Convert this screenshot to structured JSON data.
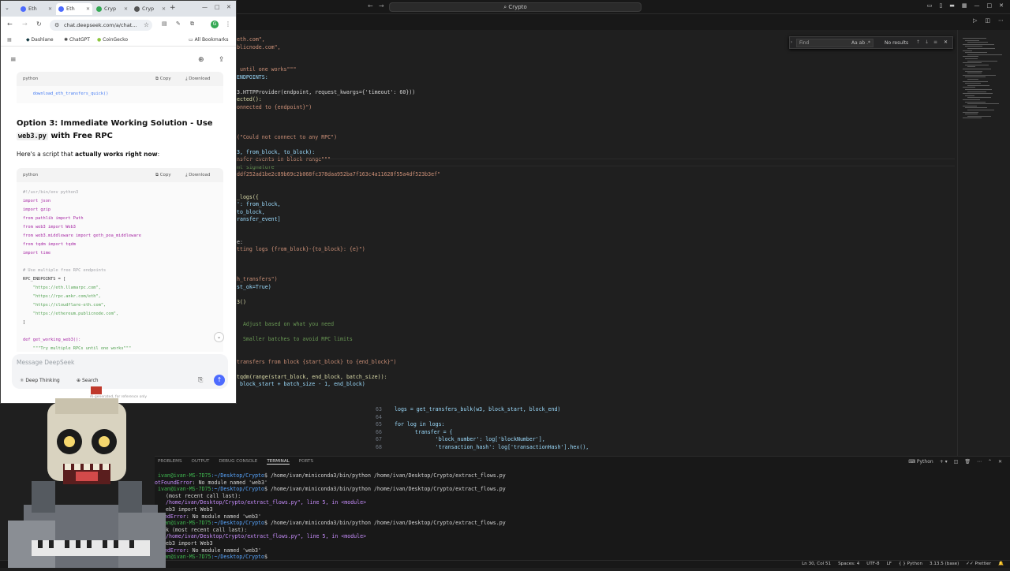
{
  "vscode": {
    "search_text": "Crypto",
    "find": {
      "placeholder": "Find",
      "aa": "Aa",
      "ab": "ab",
      "regex": ".*",
      "results": "No results"
    },
    "code_lines": [
      {
        "t": "eth.com\",",
        "c": "str"
      },
      {
        "t": "blicnode.com\",",
        "c": "str"
      },
      {
        "t": "",
        "c": ""
      },
      {
        "t": "",
        "c": ""
      },
      {
        "t": " until one works\"\"\"",
        "c": "str"
      },
      {
        "t": "ENDPOINTS:",
        "c": "var"
      },
      {
        "t": "",
        "c": ""
      },
      {
        "t": "3.HTTPProvider(endpoint, request_kwargs={'timeout': 60}))",
        "c": ""
      },
      {
        "t": "ected():",
        "c": "fn"
      },
      {
        "t": "onnected to {endpoint}\")",
        "c": "str"
      },
      {
        "t": "",
        "c": ""
      },
      {
        "t": "",
        "c": ""
      },
      {
        "t": "",
        "c": ""
      },
      {
        "t": "(\"Could not connect to any RPC\")",
        "c": "str"
      },
      {
        "t": "",
        "c": ""
      },
      {
        "t": "3, from_block, to_block):",
        "c": "var"
      },
      {
        "t": "nsfer events in block range\"\"\"",
        "c": "str"
      },
      {
        "t": "nt signature",
        "c": "com"
      },
      {
        "t": "ddf252ad1be2c89b69c2b068fc378daa952ba7f163c4a11628f55a4df523b3ef\"",
        "c": "str"
      },
      {
        "t": "",
        "c": ""
      },
      {
        "t": "",
        "c": ""
      },
      {
        "t": "_logs({",
        "c": "fn"
      },
      {
        "t": "': from_block,",
        "c": "var"
      },
      {
        "t": "to_block,",
        "c": "var"
      },
      {
        "t": "ransfer_event]",
        "c": "var"
      },
      {
        "t": "",
        "c": ""
      },
      {
        "t": "",
        "c": ""
      },
      {
        "t": "e:",
        "c": ""
      },
      {
        "t": "tting logs {from_block}-{to_block}: {e}\")",
        "c": "str"
      },
      {
        "t": "",
        "c": ""
      },
      {
        "t": "",
        "c": ""
      },
      {
        "t": "",
        "c": ""
      },
      {
        "t": "h_transfers\")",
        "c": "str"
      },
      {
        "t": "st_ok=True)",
        "c": "var"
      },
      {
        "t": "",
        "c": ""
      },
      {
        "t": "3()",
        "c": "fn"
      },
      {
        "t": "",
        "c": ""
      },
      {
        "t": "",
        "c": ""
      },
      {
        "t": "  Adjust based on what you need",
        "c": "com"
      },
      {
        "t": "",
        "c": ""
      },
      {
        "t": "  Smaller batches to avoid RPC limits",
        "c": "com"
      },
      {
        "t": "",
        "c": ""
      },
      {
        "t": "",
        "c": ""
      },
      {
        "t": "transfers from block {start_block} to {end_block}\")",
        "c": "str"
      },
      {
        "t": "",
        "c": ""
      },
      {
        "t": "tqdm(range(start_block, end_block, batch_size)):",
        "c": "fn"
      },
      {
        "t": " block_start + batch_size - 1, end_block)",
        "c": "var"
      },
      {
        "t": "",
        "c": ""
      }
    ],
    "numbered_lines": [
      {
        "n": "63",
        "t": "logs = get_transfers_bulk(w3, block_start, block_end)"
      },
      {
        "n": "64",
        "t": ""
      },
      {
        "n": "65",
        "t": "for log in logs:"
      },
      {
        "n": "66",
        "t": "    transfer = {"
      },
      {
        "n": "67",
        "t": "        'block_number': log['blockNumber'],"
      },
      {
        "n": "68",
        "t": "        'transaction_hash': log['transactionHash'].hex(),"
      }
    ],
    "panel_tabs": [
      "PROBLEMS",
      "OUTPUT",
      "DEBUG CONSOLE",
      "TERMINAL",
      "PORTS"
    ],
    "panel_active": "TERMINAL",
    "terminal_profile": "Python",
    "terminal": [
      {
        "prompt": "ivan@ivan-MS-7D75",
        "path": ":~/Desktop/Crypto",
        "cmd": "$ /home/ivan/miniconda3/bin/python /home/ivan/Desktop/Crypto/extract_flows.py"
      },
      {
        "err": "otFoundError",
        "rest": ": No module named 'web3'"
      },
      {
        "prompt": "ivan@ivan-MS-7D75",
        "path": ":~/Desktop/Crypto",
        "cmd": "$ /home/ivan/miniconda3/bin/python /home/ivan/Desktop/Crypto/extract_flows.py"
      },
      {
        "plain": "(most recent call last):"
      },
      {
        "file": "/home/ivan/Desktop/Crypto/extract_flows.py\", line 5, in <module>"
      },
      {
        "plain": "eb3 import Web3"
      },
      {
        "err": "FoundError",
        "rest": ": No module named 'web3'"
      },
      {
        "prompt": "ivan@ivan-MS-7D75",
        "path": ":~/Desktop/Crypto",
        "cmd": "$ /home/ivan/miniconda3/bin/python /home/ivan/Desktop/Crypto/extract_flows.py"
      },
      {
        "plain": "k (most recent call last):"
      },
      {
        "file": "/home/ivan/Desktop/Crypto/extract_flows.py\", line 5, in <module>"
      },
      {
        "plain": "eb3 import Web3"
      },
      {
        "err": "FoundError",
        "rest": ": No module named 'web3'"
      },
      {
        "prompt": "ivan@ivan-MS-7D75",
        "path": ":~/Desktop/Crypto",
        "cmd": "$ "
      }
    ],
    "status": {
      "position": "Ln 30, Col 51",
      "spaces": "Spaces: 4",
      "encoding": "UTF-8",
      "eol": "LF",
      "language": "Python",
      "interpreter": "3.13.5 (base)",
      "formatter": "Prettier"
    }
  },
  "chrome": {
    "tabs": [
      {
        "label": "Eth",
        "color": "#4d6bfe",
        "active": false
      },
      {
        "label": "Eth",
        "color": "#4d6bfe",
        "active": true
      },
      {
        "label": "Cryp",
        "color": "#34a853",
        "active": false
      },
      {
        "label": "Cryp",
        "color": "#555555",
        "active": false
      }
    ],
    "url": "chat.deepseek.com/a/chat...",
    "bookmarks": [
      "Dashlane",
      "ChatGPT",
      "CoinGecko"
    ],
    "all_bookmarks": "All Bookmarks"
  },
  "deepseek": {
    "block1": {
      "lang": "python",
      "copy": "Copy",
      "download": "Download",
      "last_line": "    download_eth_transfers_quick()"
    },
    "heading_part1": "Option 3: Immediate Working Solution - Use",
    "heading_code": "web3.py",
    "heading_part2": "with Free RPC",
    "intro_plain": "Here's a script that ",
    "intro_bold": "actually works right now",
    "intro_end": ":",
    "block2": {
      "lang": "python",
      "copy": "Copy",
      "download": "Download",
      "lines": [
        "#!/usr/bin/env python3",
        "import json",
        "import gzip",
        "from pathlib import Path",
        "from web3 import Web3",
        "from web3.middleware import geth_poa_middleware",
        "from tqdm import tqdm",
        "import time",
        "",
        "# Use multiple free RPC endpoints",
        "RPC_ENDPOINTS = [",
        "    \"https://eth.llamarpc.com\",",
        "    \"https://rpc.ankr.com/eth\",",
        "    \"https://cloudflare-eth.com\",",
        "    \"https://ethereum.publicnode.com\",",
        "]",
        "",
        "def get_working_web3():",
        "    \"\"\"Try multiple RPCs until one works\"\"\""
      ]
    },
    "composer_placeholder": "Message DeepSeek",
    "deep_thinking": "Deep Thinking",
    "search": "Search",
    "note": "AI-generated, for reference only"
  }
}
